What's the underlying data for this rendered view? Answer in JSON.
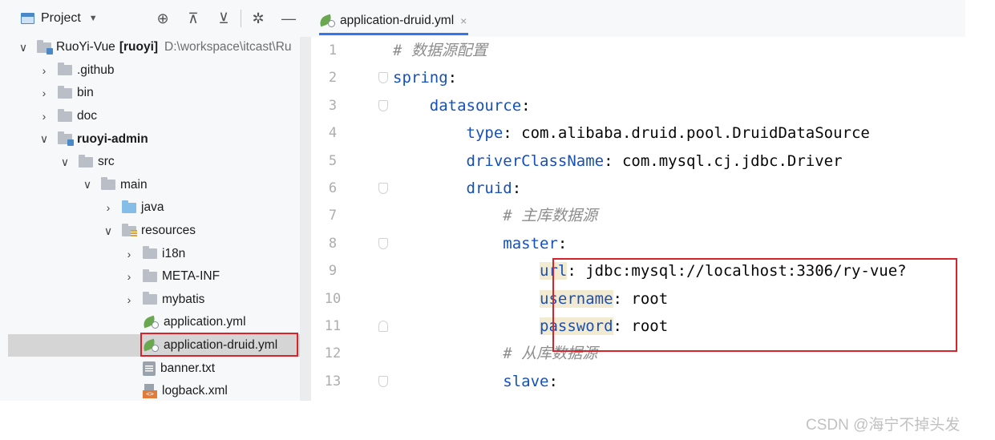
{
  "project_panel": {
    "title": "Project",
    "tree": [
      {
        "label": "RuoYi-Vue",
        "module": "[ruoyi]",
        "hint": "D:\\workspace\\itcast\\Ru",
        "depth": 0,
        "expanded": true,
        "icon": "module-folder-icon"
      },
      {
        "label": ".github",
        "depth": 1,
        "expanded": false,
        "icon": "folder-icon"
      },
      {
        "label": "bin",
        "depth": 1,
        "expanded": false,
        "icon": "folder-icon"
      },
      {
        "label": "doc",
        "depth": 1,
        "expanded": false,
        "icon": "folder-icon"
      },
      {
        "label": "ruoyi-admin",
        "depth": 1,
        "expanded": true,
        "icon": "module-folder-icon"
      },
      {
        "label": "src",
        "depth": 2,
        "expanded": true,
        "icon": "folder-icon"
      },
      {
        "label": "main",
        "depth": 3,
        "expanded": true,
        "icon": "folder-icon"
      },
      {
        "label": "java",
        "depth": 4,
        "expanded": false,
        "icon": "source-folder-icon"
      },
      {
        "label": "resources",
        "depth": 4,
        "expanded": true,
        "icon": "resources-folder-icon"
      },
      {
        "label": "i18n",
        "depth": 5,
        "expanded": false,
        "icon": "folder-icon"
      },
      {
        "label": "META-INF",
        "depth": 5,
        "expanded": false,
        "icon": "folder-icon"
      },
      {
        "label": "mybatis",
        "depth": 5,
        "expanded": false,
        "icon": "folder-icon"
      },
      {
        "label": "application.yml",
        "depth": 5,
        "icon": "yaml-file-icon"
      },
      {
        "label": "application-druid.yml",
        "depth": 5,
        "icon": "yaml-file-icon",
        "selected": true
      },
      {
        "label": "banner.txt",
        "depth": 5,
        "icon": "text-file-icon"
      },
      {
        "label": "logback.xml",
        "depth": 5,
        "icon": "xml-file-icon"
      }
    ]
  },
  "editor": {
    "tab_label": "application-druid.yml",
    "lines": [
      {
        "n": "1",
        "parts": [
          {
            "t": "# 数据源配置",
            "s": "c"
          }
        ]
      },
      {
        "n": "2",
        "parts": [
          {
            "t": "spring",
            "s": "k"
          },
          {
            "t": ":",
            "s": "v"
          }
        ]
      },
      {
        "n": "3",
        "parts": [
          {
            "t": "    datasource",
            "s": "k"
          },
          {
            "t": ":",
            "s": "v"
          }
        ]
      },
      {
        "n": "4",
        "parts": [
          {
            "t": "        type",
            "s": "k"
          },
          {
            "t": ": com.alibaba.druid.pool.DruidDataSource",
            "s": "v"
          }
        ]
      },
      {
        "n": "5",
        "parts": [
          {
            "t": "        driverClassName",
            "s": "k"
          },
          {
            "t": ": com.mysql.cj.jdbc.Driver",
            "s": "v"
          }
        ]
      },
      {
        "n": "6",
        "parts": [
          {
            "t": "        druid",
            "s": "k"
          },
          {
            "t": ":",
            "s": "v"
          }
        ]
      },
      {
        "n": "7",
        "parts": [
          {
            "t": "            # 主库数据源",
            "s": "c"
          }
        ]
      },
      {
        "n": "8",
        "parts": [
          {
            "t": "            master",
            "s": "k"
          },
          {
            "t": ":",
            "s": "v"
          }
        ]
      },
      {
        "n": "9",
        "parts": [
          {
            "t": "                ",
            "s": "v"
          },
          {
            "t": "url",
            "s": "k hl"
          },
          {
            "t": ": jdbc:mysql://localhost:3306/ry-vue?",
            "s": "v"
          }
        ]
      },
      {
        "n": "10",
        "parts": [
          {
            "t": "                ",
            "s": "v"
          },
          {
            "t": "username",
            "s": "k hl"
          },
          {
            "t": ": root",
            "s": "v"
          }
        ]
      },
      {
        "n": "11",
        "parts": [
          {
            "t": "                ",
            "s": "v"
          },
          {
            "t": "password",
            "s": "k hl"
          },
          {
            "t": ": root",
            "s": "v"
          }
        ]
      },
      {
        "n": "12",
        "parts": [
          {
            "t": "            # 从库数据源",
            "s": "c"
          }
        ]
      },
      {
        "n": "13",
        "parts": [
          {
            "t": "            slave",
            "s": "k"
          },
          {
            "t": ":",
            "s": "v"
          }
        ]
      }
    ]
  },
  "watermark": "CSDN @海宁不掉头发"
}
